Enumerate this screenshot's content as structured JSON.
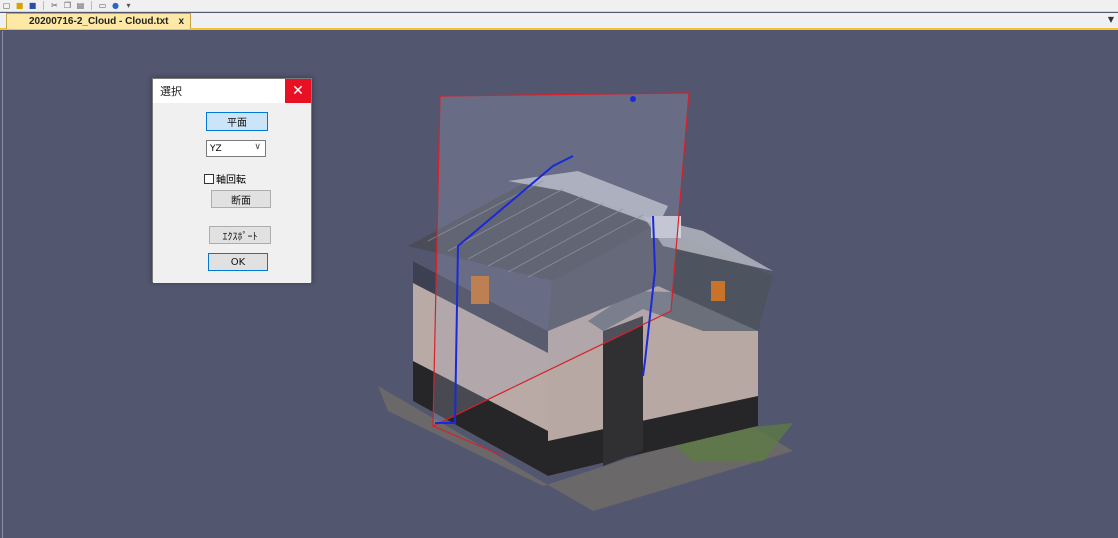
{
  "toolbar": {
    "icons": [
      "new-file-icon",
      "open-folder-icon",
      "save-icon",
      "cut-icon",
      "copy-icon",
      "paste-icon",
      "print-icon",
      "help-icon",
      "overflow-icon"
    ]
  },
  "tabs": [
    {
      "label": "20200716-2_Cloud - Cloud.txt",
      "close": "x",
      "active": true
    }
  ],
  "dialog": {
    "title": "選択",
    "close_glyph": "✕",
    "plane_button": "平面",
    "axis_select_value": "YZ",
    "rotate_axis_label": "軸回転",
    "rotate_axis_checked": false,
    "section_button": "断面",
    "export_button": "ｴｸｽﾎﾟｰﾄ",
    "ok_button": "OK"
  },
  "colors": {
    "viewport_bg": "#52566f",
    "tab_accent": "#f5c233",
    "clip_plane_outline": "#d8202a",
    "section_line": "#1a2ad8",
    "close_red": "#e81123"
  }
}
